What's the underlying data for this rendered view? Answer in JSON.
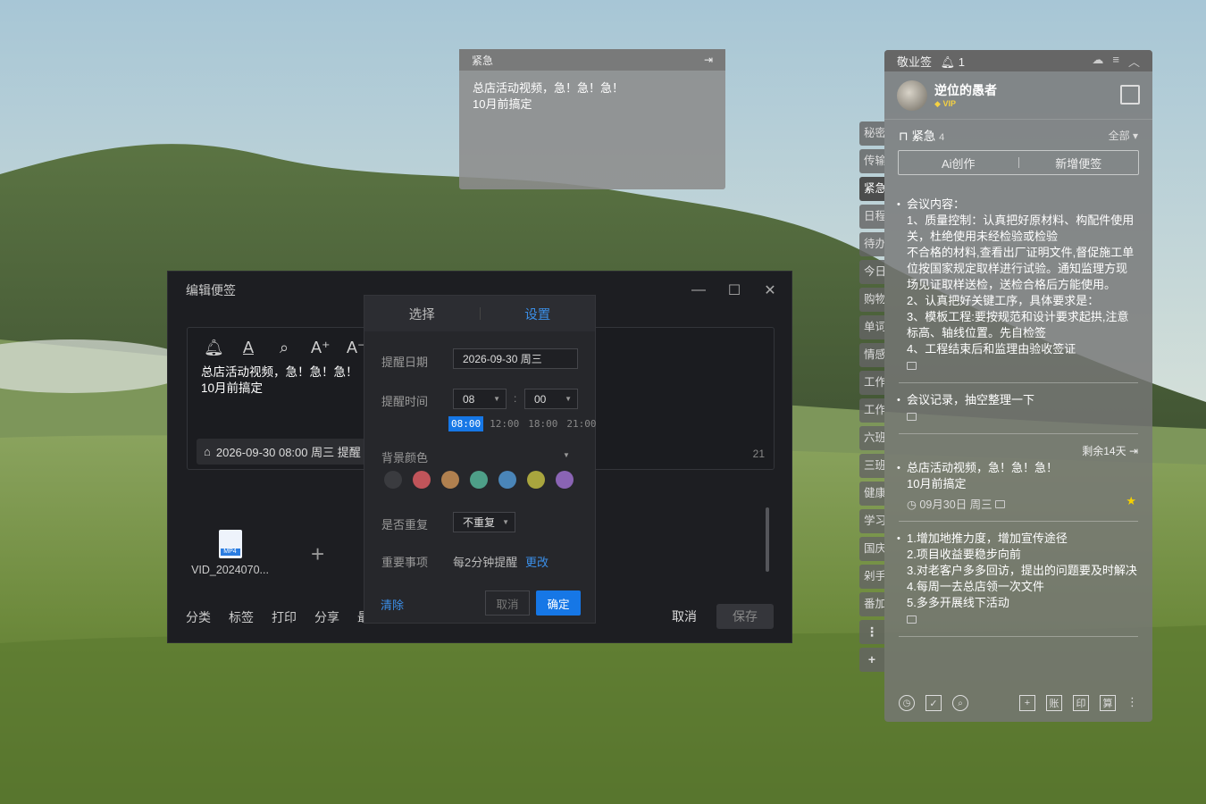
{
  "sticky": {
    "title": "紧急",
    "content": "总店活动视频，急！急！急！\n10月前搞定"
  },
  "editor": {
    "title": "编辑便签",
    "toolbar": [
      "bell-icon",
      "font-color-icon",
      "search-icon",
      "font-size-up-icon",
      "font-size-down-icon"
    ],
    "content": "总店活动视频，急！急！急！\n10月前搞定",
    "reminder_chip": "2026-09-30 08:00 周三 提醒",
    "char_count": "21",
    "attachment_name": "VID_2024070...",
    "attachment_type": "MP4",
    "bottom_actions": [
      "分类",
      "标签",
      "打印",
      "分享",
      "最"
    ],
    "cancel": "取消",
    "save": "保存"
  },
  "popup": {
    "tabs": [
      "选择",
      "设置"
    ],
    "date_label": "提醒日期",
    "date_value": "2026-09-30  周三",
    "time_label": "提醒时间",
    "hour": "08",
    "minute": "00",
    "colon": ":",
    "quick_times": [
      "08:00",
      "12:00",
      "18:00",
      "21:00"
    ],
    "bg_label": "背景颜色",
    "swatches": [
      "#3a3b3f",
      "#c0545a",
      "#b0804f",
      "#4e9f88",
      "#4a85b8",
      "#a9a53e",
      "#8a64b4"
    ],
    "repeat_label": "是否重复",
    "repeat_value": "不重复",
    "important_label": "重要事项",
    "important_value": "每2分钟提醒",
    "change": "更改",
    "clear": "清除",
    "cancel": "取消",
    "ok": "确定"
  },
  "side_tabs": [
    "秘密",
    "传输",
    "紧急",
    "日程",
    "待办",
    "今日",
    "购物",
    "单词",
    "情感",
    "工作",
    "工作",
    "六班",
    "三班",
    "健康",
    "学习",
    "国庆",
    "剁手",
    "番加"
  ],
  "panel": {
    "title": "敬业签",
    "notify_count": "1",
    "user": "逆位的愚者",
    "vip": "VIP",
    "category": "紧急",
    "category_count": "4",
    "filter": "全部",
    "ai": "Ai创作",
    "new_note": "新增便签",
    "notes": [
      {
        "body": "会议内容：\n1、质量控制：认真把好原材料、构配件使用关，杜绝使用未经检验或检验\n不合格的材料,查看出厂证明文件,督促施工单位按国家规定取样进行试验。通知监理方现场见证取样送检，送检合格后方能使用。\n2、认真把好关键工序，具体要求是：\n3、模板工程:要按规范和设计要求起拱,注意标高、轴线位置。先自检签\n4、工程结束后和监理由验收签证"
      },
      {
        "body": "会议记录，抽空整理一下"
      },
      {
        "remain": "剩余14天",
        "body": "总店活动视频，急！急！急！\n10月前搞定",
        "date": "09月30日 周三"
      },
      {
        "body": "1.增加地推力度，增加宣传途径\n2.项目收益要稳步向前\n3.对老客户多多回访，提出的问题要及时解决\n4.每周一去总店领一次文件\n5.多多开展线下活动"
      }
    ],
    "footer_right": [
      "+",
      "账",
      "印",
      "算"
    ]
  }
}
